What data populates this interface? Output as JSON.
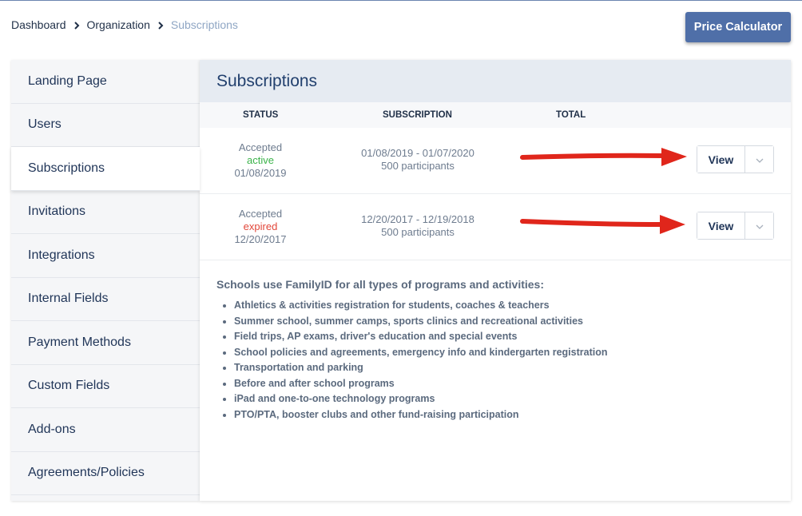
{
  "breadcrumb": {
    "items": [
      "Dashboard",
      "Organization",
      "Subscriptions"
    ]
  },
  "header": {
    "price_calculator_label": "Price Calculator"
  },
  "sidebar": {
    "items": [
      {
        "label": "Landing Page"
      },
      {
        "label": "Users"
      },
      {
        "label": "Subscriptions"
      },
      {
        "label": "Invitations"
      },
      {
        "label": "Integrations"
      },
      {
        "label": "Internal Fields"
      },
      {
        "label": "Payment Methods"
      },
      {
        "label": "Custom Fields"
      },
      {
        "label": "Add-ons"
      },
      {
        "label": "Agreements/Policies"
      }
    ],
    "active": "Subscriptions"
  },
  "main": {
    "title": "Subscriptions",
    "columns": {
      "status": "STATUS",
      "subscription": "SUBSCRIPTION",
      "total": "TOTAL"
    },
    "rows": [
      {
        "status": "Accepted",
        "state": "active",
        "date": "01/08/2019",
        "period": "01/08/2019 - 01/07/2020",
        "participants": "500 participants",
        "total": "",
        "view_label": "View"
      },
      {
        "status": "Accepted",
        "state": "expired",
        "date": "12/20/2017",
        "period": "12/20/2017 - 12/19/2018",
        "participants": "500 participants",
        "total": "",
        "view_label": "View"
      }
    ],
    "info": {
      "title": "Schools use FamilyID for all types of programs and activities:",
      "items": [
        "Athletics & activities registration for students, coaches & teachers",
        "Summer school, summer camps, sports clinics and recreational activities",
        "Field trips, AP exams, driver's education and special events",
        "School policies and agreements, emergency info and kindergarten registration",
        "Transportation and parking",
        "Before and after school programs",
        "iPad and one-to-one technology programs",
        "PTO/PTA, booster clubs and other fund-raising participation"
      ]
    }
  },
  "colors": {
    "accent": "#4f6fa8",
    "active": "#3bb34a",
    "expired": "#e2473a",
    "arrow": "#e0261b"
  },
  "icons": {
    "breadcrumb_separator": "chevron-right-icon",
    "dropdown": "chevron-down-icon",
    "annotation": "red-arrow-icon"
  }
}
